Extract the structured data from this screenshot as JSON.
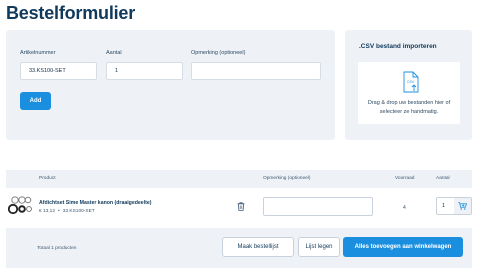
{
  "page": {
    "title": "Bestelformulier"
  },
  "order_form": {
    "article_label": "Artikelnummer",
    "article_value": "33.KS100-SET",
    "quantity_label": "Aantal",
    "quantity_value": "1",
    "remark_label": "Opmerking (optioneel)",
    "remark_value": "",
    "add_button": "Add"
  },
  "csv_import": {
    "title": ".CSV bestand importeren",
    "dropzone_line1": "Drag & drop uw bestanden hier of",
    "dropzone_line2": "selecteer ze handmatig."
  },
  "table": {
    "headers": {
      "product": "Product",
      "remark": "Opmerking (optioneel)",
      "stock": "Voorraad",
      "quantity": "Aantal"
    },
    "rows": [
      {
        "name": "Afdichtset Sime Master kanon (draaigedeelte)",
        "price": "€ 13,12",
        "sku": "33.KS100-SET",
        "remark": "",
        "stock": "4",
        "quantity": "1"
      }
    ]
  },
  "footer": {
    "total_text": "Totaal 1 producten",
    "create_list_button": "Maak bestellijst",
    "clear_list_button": "Lijst legen",
    "add_all_button": "Alles toevoegen aan winkelwagen"
  },
  "colors": {
    "primary": "#1a8fe0",
    "heading": "#103a5c",
    "panel": "#eef2f6"
  }
}
